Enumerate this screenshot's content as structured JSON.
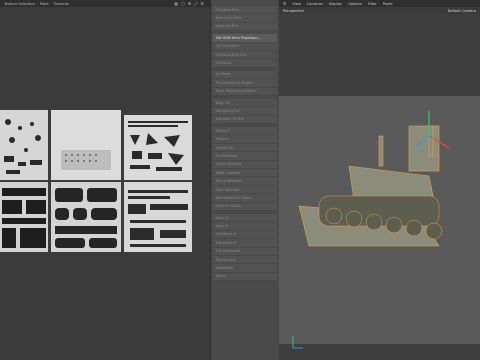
{
  "uv_panel": {
    "menu": [
      "Texture Selection",
      "Paint",
      "Textures"
    ],
    "icons": [
      "grid-icon",
      "frame-icon",
      "move-icon",
      "expand-icon",
      "settings-icon"
    ]
  },
  "command_list": {
    "group1": [
      {
        "label": "Combine Pins",
        "hi": false
      },
      {
        "label": "Relax UVs Pins",
        "hi": false
      },
      {
        "label": "Align UV Pins",
        "hi": false
      }
    ],
    "group2": [
      {
        "label": "Set UVW from Projection...",
        "hi": true
      },
      {
        "label": "UV Transform",
        "hi": false
      },
      {
        "label": "UV Mirror/Flip Pins",
        "hi": false
      },
      {
        "label": "UV Mirror",
        "hi": false
      }
    ],
    "group3": [
      {
        "label": "UV Relax",
        "hi": false
      },
      {
        "label": "Fit Selected to Region",
        "hi": false
      },
      {
        "label": "Pack Selected to Region",
        "hi": false
      }
    ],
    "group4": [
      {
        "label": "Align UV",
        "hi": false
      },
      {
        "label": "Straighten UV",
        "hi": false
      },
      {
        "label": "Equalize UV Size",
        "hi": false
      }
    ],
    "group5": [
      {
        "label": "Mirror U",
        "hi": false
      },
      {
        "label": "Mirror V",
        "hi": false
      },
      {
        "label": "Rotate 90°",
        "hi": false
      },
      {
        "label": "Pin Selected",
        "hi": false
      },
      {
        "label": "Unpin Selected",
        "hi": false
      },
      {
        "label": "Weld Selected",
        "hi": false
      },
      {
        "label": "Stitch Selected",
        "hi": false
      },
      {
        "label": "Split Selected",
        "hi": false
      },
      {
        "label": "Randomize UV Shells",
        "hi": false
      },
      {
        "label": "Pack UV Shells",
        "hi": false
      }
    ],
    "group6": [
      {
        "label": "Align U",
        "hi": false
      },
      {
        "label": "Align V",
        "hi": false
      },
      {
        "label": "Distribute U",
        "hi": false
      },
      {
        "label": "Distribute V",
        "hi": false
      },
      {
        "label": "Flip Horizontal",
        "hi": false
      },
      {
        "label": "Flip Vertical",
        "hi": false
      },
      {
        "label": "Normalize",
        "hi": false
      },
      {
        "label": "Relax",
        "hi": false
      }
    ]
  },
  "viewport": {
    "menu": [
      "View",
      "Cameras",
      "Display",
      "Options",
      "Filter",
      "Panel"
    ],
    "projection": "Perspective",
    "camera": "Default Camera"
  },
  "colors": {
    "accent": "#e8a24a",
    "background": "#3a3a3a"
  }
}
